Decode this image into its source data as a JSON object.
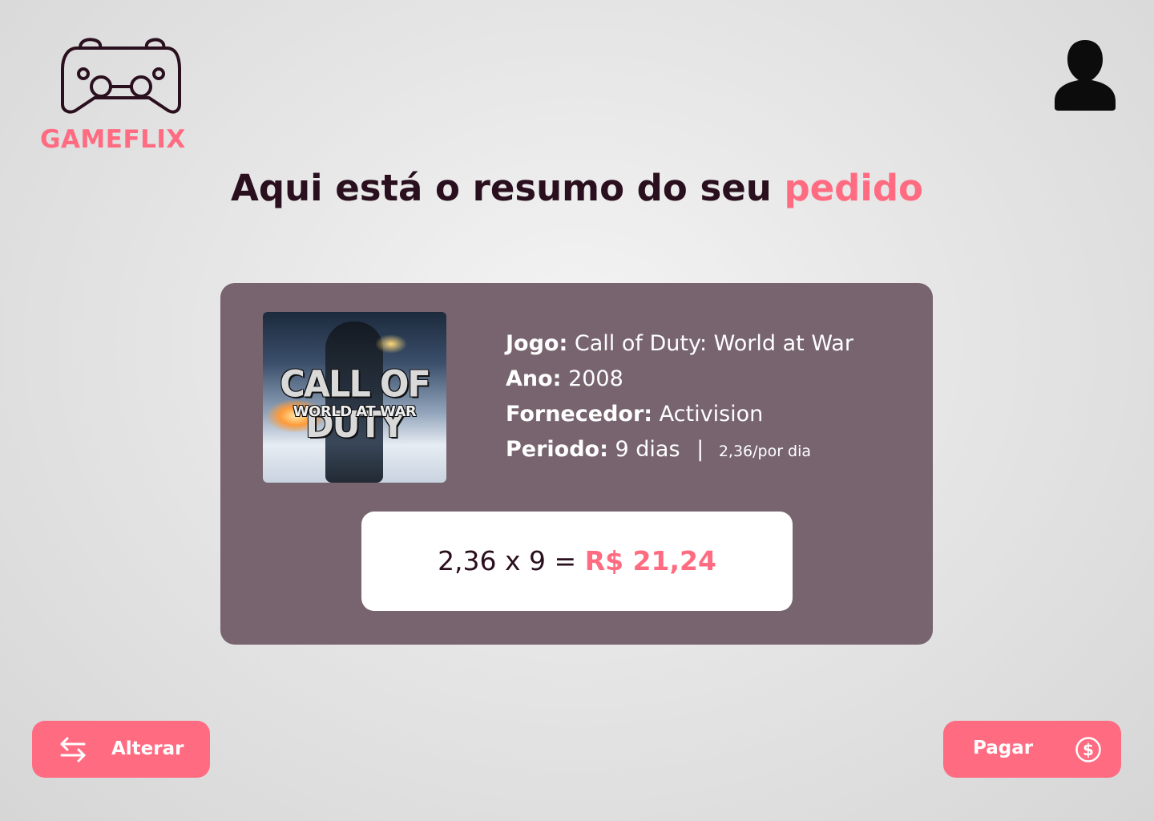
{
  "brand": {
    "name": "GAMEFLIX",
    "accent_color": "#ff6b81"
  },
  "header": {
    "logo_icon": "gamepad-icon",
    "user_icon": "user-icon"
  },
  "title": {
    "main": "Aqui está o resumo do seu ",
    "accent": "pedido"
  },
  "order": {
    "cover_alt": "Call of Duty: World at War cover",
    "cover_text_line1": "CALL OF DUTY",
    "cover_text_line2": "WORLD AT WAR",
    "game_label": "Jogo:",
    "game_value": "Call of Duty: World at War",
    "year_label": "Ano:",
    "year_value": "2008",
    "supplier_label": "Fornecedor:",
    "supplier_value": "Activision",
    "period_label": "Periodo:",
    "period_value": "9 dias",
    "period_separator": "|",
    "per_day": "2,36/por dia",
    "formula": "2,36 x 9 = ",
    "total": "R$ 21,24"
  },
  "actions": {
    "change_label": "Alterar",
    "change_icon": "swap-arrows-icon",
    "pay_label": "Pagar",
    "pay_icon": "dollar-circle-icon"
  }
}
